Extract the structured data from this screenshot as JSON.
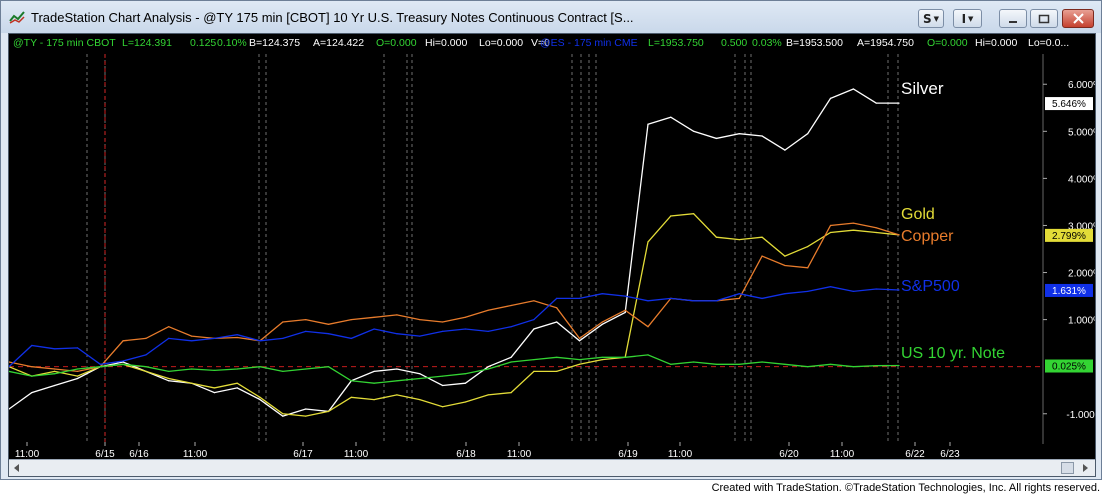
{
  "window": {
    "title": "TradeStation Chart Analysis - @TY 175 min [CBOT] 10 Yr U.S. Treasury Notes Continuous Contract [S...",
    "buttons": {
      "styles": "S",
      "objects": "I"
    }
  },
  "footer": "Created with TradeStation. ©TradeStation Technologies, Inc. All rights reserved.",
  "colors": {
    "background": "#000000",
    "silver": "#ffffff",
    "gold": "#e3dc38",
    "copper": "#e87c2c",
    "sp500": "#1030e8",
    "note": "#33d433",
    "grid": "#8a8a8a",
    "baseline": "#e02020"
  },
  "chart_data": {
    "type": "line",
    "status_ty": {
      "symbol": "@TY - 175 min  CBOT",
      "last": "L=124.391",
      "change": "0.125",
      "percent": "0.10%",
      "bid": "B=124.375",
      "ask": "A=124.422",
      "open": "O=0.000",
      "high": "Hi=0.000",
      "low": "Lo=0.000",
      "volume": "V=0"
    },
    "status_es": {
      "symbol": "@ES - 175 min  CME",
      "last": "L=1953.750",
      "change": "0.500",
      "percent": "0.03%",
      "bid": "B=1953.500",
      "ask": "A=1954.750",
      "open": "O=0.000",
      "high": "Hi=0.000",
      "low": "Lo=0.0..."
    },
    "x_labels": [
      "11:00",
      "6/15",
      "6/16",
      "11:00",
      "6/17",
      "11:00",
      "6/18",
      "11:00",
      "6/19",
      "11:00",
      "6/20",
      "11:00",
      "6/22",
      "6/23"
    ],
    "y_ticks": [
      "6.000%",
      "5.000%",
      "4.000%",
      "3.000%",
      "2.000%",
      "1.000%",
      "-1.000%"
    ],
    "ylim": [
      -1.6,
      6.6
    ],
    "series": [
      {
        "name": "Silver",
        "color_key": "silver",
        "last_label": "5.646%",
        "values": [
          -0.9,
          -0.55,
          -0.4,
          -0.25,
          0.0,
          0.1,
          -0.1,
          -0.3,
          -0.35,
          -0.55,
          -0.45,
          -0.7,
          -1.05,
          -0.9,
          -0.95,
          -0.3,
          -0.1,
          -0.05,
          -0.15,
          -0.4,
          -0.35,
          0.0,
          0.2,
          0.8,
          0.95,
          0.55,
          0.9,
          1.15,
          5.15,
          5.3,
          5.0,
          4.85,
          4.95,
          4.9,
          4.6,
          4.95,
          5.7,
          5.9,
          5.6,
          5.6
        ]
      },
      {
        "name": "Gold",
        "color_key": "gold",
        "last_label": "2.799%",
        "values": [
          0.0,
          -0.2,
          -0.1,
          -0.2,
          0.0,
          0.05,
          -0.1,
          -0.25,
          -0.35,
          -0.45,
          -0.35,
          -0.65,
          -1.0,
          -1.05,
          -0.95,
          -0.65,
          -0.7,
          -0.6,
          -0.7,
          -0.85,
          -0.75,
          -0.6,
          -0.55,
          -0.1,
          -0.1,
          0.05,
          0.15,
          0.2,
          2.65,
          3.2,
          3.25,
          2.75,
          2.7,
          2.75,
          2.35,
          2.55,
          2.85,
          2.9,
          2.85,
          2.8
        ]
      },
      {
        "name": "Copper",
        "color_key": "copper",
        "last_label": "",
        "values": [
          0.1,
          0.0,
          -0.05,
          -0.1,
          0.0,
          0.55,
          0.6,
          0.85,
          0.65,
          0.6,
          0.62,
          0.55,
          0.95,
          1.0,
          0.9,
          1.0,
          1.05,
          1.1,
          1.0,
          0.95,
          1.05,
          1.2,
          1.3,
          1.4,
          1.25,
          0.6,
          0.95,
          1.2,
          0.85,
          1.45,
          1.4,
          1.4,
          1.45,
          2.35,
          2.15,
          2.1,
          3.0,
          3.05,
          2.95,
          2.8
        ]
      },
      {
        "name": "S&P500",
        "color_key": "sp500",
        "last_label": "1.631%",
        "values": [
          0.0,
          0.45,
          0.38,
          0.4,
          0.05,
          0.12,
          0.25,
          0.6,
          0.55,
          0.6,
          0.68,
          0.55,
          0.6,
          0.75,
          0.7,
          0.6,
          0.8,
          0.7,
          0.65,
          0.75,
          0.8,
          0.75,
          0.85,
          1.0,
          1.45,
          1.45,
          1.55,
          1.5,
          1.4,
          1.45,
          1.4,
          1.4,
          1.55,
          1.45,
          1.55,
          1.6,
          1.7,
          1.6,
          1.65,
          1.63
        ]
      },
      {
        "name": "US 10 yr. Note",
        "color_key": "note",
        "last_label": "0.025%",
        "values": [
          -0.1,
          -0.2,
          -0.15,
          -0.05,
          0.0,
          0.05,
          0.0,
          -0.1,
          -0.05,
          -0.08,
          -0.05,
          0.0,
          -0.1,
          -0.05,
          0.0,
          -0.3,
          -0.35,
          -0.3,
          -0.25,
          -0.2,
          -0.15,
          -0.05,
          0.1,
          0.15,
          0.2,
          0.15,
          0.2,
          0.2,
          0.25,
          0.05,
          0.1,
          0.05,
          0.05,
          0.1,
          0.05,
          0.0,
          0.05,
          0.0,
          0.02,
          0.025
        ]
      }
    ]
  }
}
